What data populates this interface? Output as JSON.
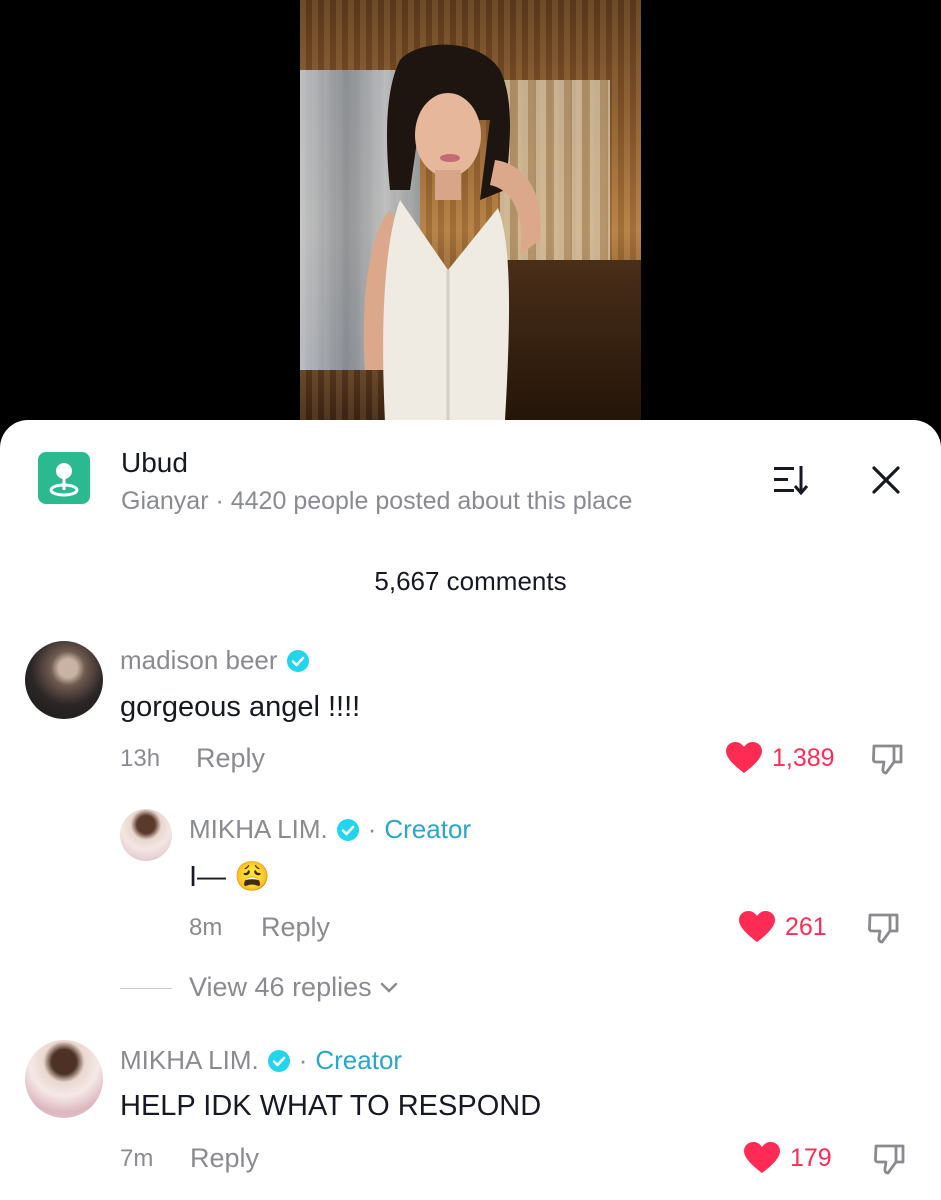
{
  "place": {
    "title": "Ubud",
    "subtitle": "Gianyar · 4420 people posted about this place"
  },
  "comments_header": "5,667 comments",
  "comments": [
    {
      "username": "madison beer",
      "verified": true,
      "text": "gorgeous angel !!!!",
      "time": "13h",
      "reply_label": "Reply",
      "likes": "1,389",
      "liked": true
    },
    {
      "username": "MIKHA LIM.",
      "verified": true,
      "creator_sep": "·",
      "creator_label": "Creator",
      "text": "I— 😩",
      "time": "8m",
      "reply_label": "Reply",
      "likes": "261",
      "liked": true,
      "is_reply": true
    },
    {
      "username": "MIKHA LIM.",
      "verified": true,
      "creator_sep": "·",
      "creator_label": "Creator",
      "text": "HELP IDK WHAT TO RESPOND",
      "time": "7m",
      "reply_label": "Reply",
      "likes": "179",
      "liked": true
    }
  ],
  "view_replies": "View 46 replies",
  "icons": {
    "place": "location-pin-icon",
    "sort": "sort-icon",
    "close": "close-icon",
    "verified": "verified-badge-icon",
    "like": "heart-icon",
    "dislike": "thumbs-down-icon",
    "expand": "chevron-down-icon"
  },
  "colors": {
    "place_icon_bg": "#2bb990",
    "like": "#fe2c55",
    "verified": "#20d5ec",
    "creator": "#2aa6c9",
    "muted": "#8a8b91"
  }
}
